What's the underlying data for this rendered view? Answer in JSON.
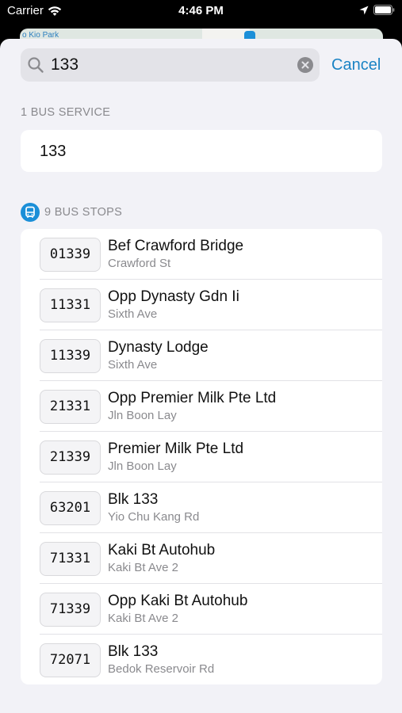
{
  "status_bar": {
    "carrier": "Carrier",
    "time": "4:46 PM",
    "icons": [
      "wifi-icon",
      "location-arrow-icon",
      "battery-icon"
    ]
  },
  "map": {
    "label": "o Kio Park"
  },
  "search": {
    "value": "133",
    "cancel_label": "Cancel",
    "icons": [
      "search-icon",
      "clear-icon"
    ]
  },
  "services": {
    "header": "1 BUS SERVICE",
    "items": [
      {
        "label": "133"
      }
    ]
  },
  "stops": {
    "header": "9 BUS STOPS",
    "header_icon": "bus-icon",
    "items": [
      {
        "code": "01339",
        "name": "Bef Crawford Bridge",
        "road": "Crawford St"
      },
      {
        "code": "11331",
        "name": "Opp Dynasty Gdn Ii",
        "road": "Sixth Ave"
      },
      {
        "code": "11339",
        "name": "Dynasty Lodge",
        "road": "Sixth Ave"
      },
      {
        "code": "21331",
        "name": "Opp Premier Milk Pte Ltd",
        "road": "Jln Boon Lay"
      },
      {
        "code": "21339",
        "name": "Premier Milk Pte Ltd",
        "road": "Jln Boon Lay"
      },
      {
        "code": "63201",
        "name": "Blk 133",
        "road": "Yio Chu Kang Rd"
      },
      {
        "code": "71331",
        "name": "Kaki Bt Autohub",
        "road": "Kaki Bt Ave 2"
      },
      {
        "code": "71339",
        "name": "Opp Kaki Bt Autohub",
        "road": "Kaki Bt Ave 2"
      },
      {
        "code": "72071",
        "name": "Blk 133",
        "road": "Bedok Reservoir Rd"
      }
    ]
  },
  "colors": {
    "accent": "#1a83c4",
    "bus_badge": "#1b8fd8",
    "sheet_bg": "#f2f2f7",
    "secondary_text": "#8a8a8e"
  }
}
